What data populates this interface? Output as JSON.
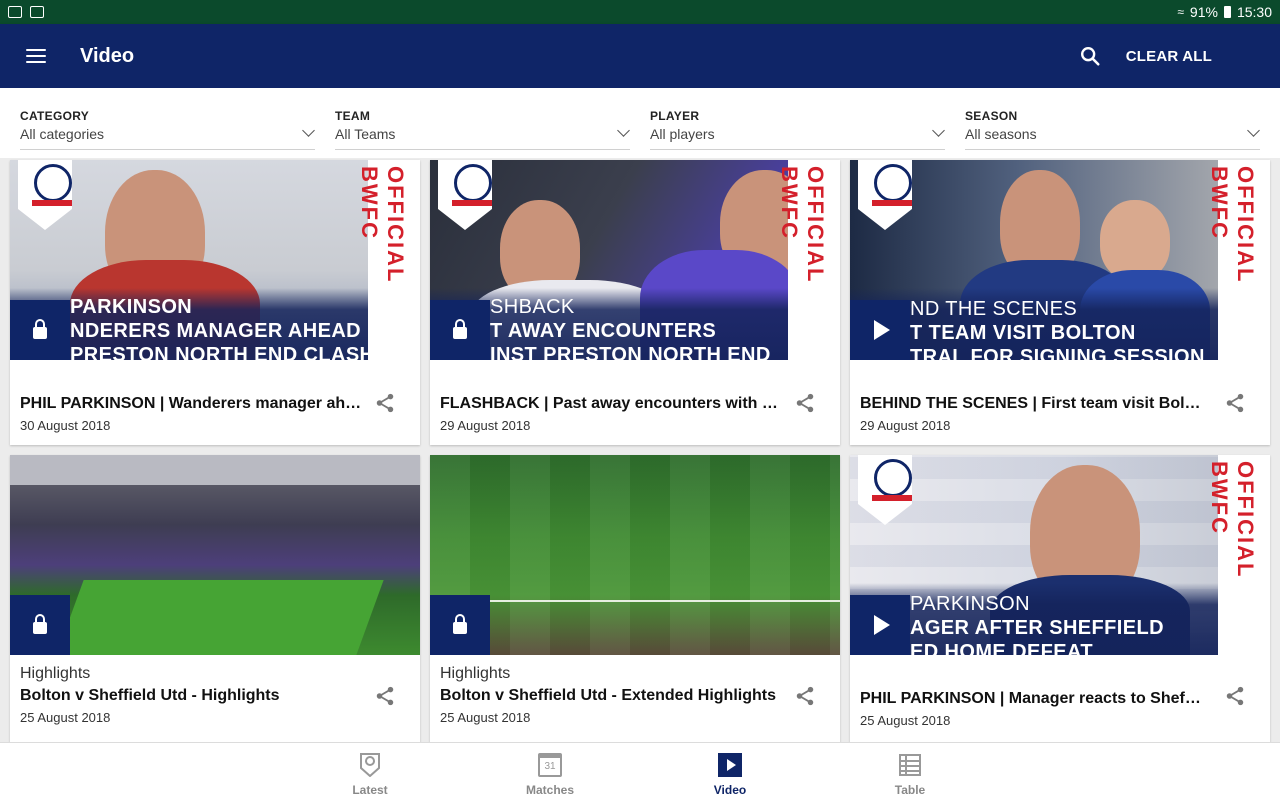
{
  "status_bar": {
    "battery": "91%",
    "time": "15:30"
  },
  "app_bar": {
    "title": "Video",
    "clear_all": "CLEAR ALL"
  },
  "filters": [
    {
      "label": "CATEGORY",
      "value": "All categories"
    },
    {
      "label": "TEAM",
      "value": "All Teams"
    },
    {
      "label": "PLAYER",
      "value": "All players"
    },
    {
      "label": "SEASON",
      "value": "All seasons"
    }
  ],
  "cards": [
    {
      "category": "",
      "title": "PHIL PARKINSON | Wanderers manager ahead of Preston North End clash",
      "date": "30 August 2018",
      "badge": "lock",
      "overlay": [
        "PARKINSON",
        "NDERERS MANAGER AHEAD",
        "PRESTON NORTH END CLASH"
      ],
      "thumb": "interview"
    },
    {
      "category": "",
      "title": "FLASHBACK | Past away encounters with Preston North End",
      "date": "29 August 2018",
      "badge": "lock",
      "overlay": [
        "SHBACK",
        "T AWAY ENCOUNTERS",
        "INST PRESTON NORTH END"
      ],
      "thumb": "action"
    },
    {
      "category": "",
      "title": "BEHIND THE SCENES | First team visit Bolton Central for signing session",
      "date": "29 August 2018",
      "badge": "play",
      "overlay": [
        "ND THE SCENES",
        "T TEAM VISIT BOLTON",
        "TRAL FOR SIGNING SESSION"
      ],
      "thumb": "studio"
    },
    {
      "category": "Highlights",
      "title": "Bolton v Sheffield Utd - Highlights",
      "date": "25 August 2018",
      "badge": "lock",
      "overlay": [],
      "thumb": "stadium"
    },
    {
      "category": "Highlights",
      "title": "Bolton v Sheffield Utd - Extended Highlights",
      "date": "25 August 2018",
      "badge": "lock",
      "overlay": [],
      "thumb": "pitch"
    },
    {
      "category": "",
      "title": "PHIL PARKINSON | Manager reacts to Sheffield United home defeat",
      "date": "25 August 2018",
      "badge": "play",
      "overlay": [
        "PARKINSON",
        "AGER AFTER SHEFFIELD",
        "ED HOME DEFEAT"
      ],
      "thumb": "press"
    }
  ],
  "official_label": "OFFICIAL BWFC",
  "bottom_nav": [
    {
      "label": "Latest",
      "icon": "crest-icon"
    },
    {
      "label": "Matches",
      "icon": "calendar-icon",
      "calendar_day": "31"
    },
    {
      "label": "Video",
      "icon": "play-icon",
      "active": true
    },
    {
      "label": "Table",
      "icon": "table-icon"
    }
  ],
  "colors": {
    "status_bar": "#0b4a2c",
    "app_bar": "#0f2567",
    "accent_red": "#d4202b"
  }
}
